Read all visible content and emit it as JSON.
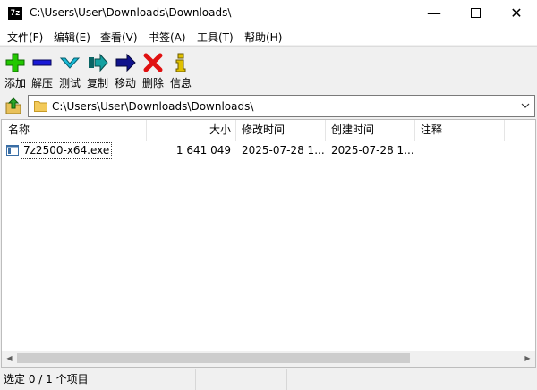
{
  "window": {
    "app_icon_text": "7z",
    "title": "C:\\Users\\User\\Downloads\\Downloads\\",
    "buttons": {
      "minimize": "—",
      "close": "✕"
    }
  },
  "menu": {
    "items": [
      "文件(F)",
      "编辑(E)",
      "查看(V)",
      "书签(A)",
      "工具(T)",
      "帮助(H)"
    ]
  },
  "toolbar": {
    "buttons": [
      {
        "label": "添加",
        "icon": "add-icon",
        "color": "#22c800"
      },
      {
        "label": "解压",
        "icon": "extract-icon",
        "color": "#1a1ad6"
      },
      {
        "label": "测试",
        "icon": "test-icon",
        "color": "#17b9d6"
      },
      {
        "label": "复制",
        "icon": "copy-icon",
        "color": "#14a0a0"
      },
      {
        "label": "移动",
        "icon": "move-icon",
        "color": "#10128c"
      },
      {
        "label": "删除",
        "icon": "delete-icon",
        "color": "#e01010"
      },
      {
        "label": "信息",
        "icon": "info-icon",
        "color": "#e0c000"
      }
    ]
  },
  "address": {
    "value": "C:\\Users\\User\\Downloads\\Downloads\\",
    "dropdown_icon": "chevron-down-icon"
  },
  "list": {
    "columns": [
      "名称",
      "大小",
      "修改时间",
      "创建时间",
      "注释"
    ],
    "rows": [
      {
        "name": "7z2500-x64.exe",
        "size": "1 641 049",
        "modified": "2025-07-28 1...",
        "created": "2025-07-28 1...",
        "comment": ""
      }
    ]
  },
  "status": {
    "selection": "选定 0 / 1 个项目",
    "seg2": "",
    "seg3": "",
    "seg4": ""
  }
}
